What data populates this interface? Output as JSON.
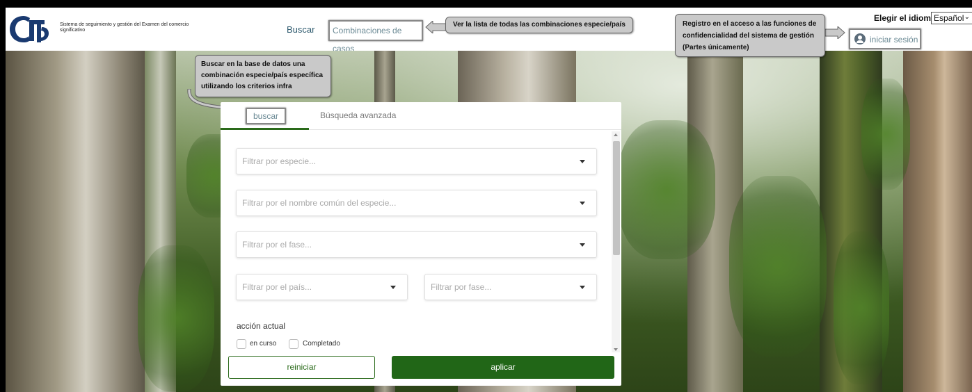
{
  "header": {
    "org_name": "Sistema de seguimiento y gestión del Examen del comercio significativo",
    "nav_buscar": "Buscar",
    "nav_combinaciones": "Combinaciones de casos",
    "language_label": "Elegir el idioma :",
    "language_selected": "Español",
    "login_label": "iniciar sesión",
    "logo_icon": "cites-logo"
  },
  "callouts": {
    "list": "Ver la lista de todas las combinaciones especie/país",
    "login": "Registro en el acceso a las funciones de confidencialidad del sistema de gestión (Partes únicamente)",
    "search": "Buscar en la base de datos una combinación especie/país específica utilizando los criterios infra"
  },
  "panel": {
    "tabs": [
      {
        "label": "buscar",
        "active": true
      },
      {
        "label": "Búsqueda avanzada",
        "active": false
      }
    ],
    "filters": {
      "species": "Filtrar por especie...",
      "common_name": "Filtrar por el nombre común del especie...",
      "phase": "Filtrar por el fase...",
      "country": "Filtrar por el país...",
      "stage": "Filtrar por fase..."
    },
    "current_action_label": "acción actual",
    "checkboxes": [
      {
        "label": "en curso",
        "checked": false
      },
      {
        "label": "Completado",
        "checked": false
      }
    ],
    "reset_label": "reiniciar",
    "apply_label": "aplicar"
  },
  "colors": {
    "primary_green": "#216617",
    "link_blue": "#2e5a6e",
    "callout_gray": "#c9c9c9"
  }
}
